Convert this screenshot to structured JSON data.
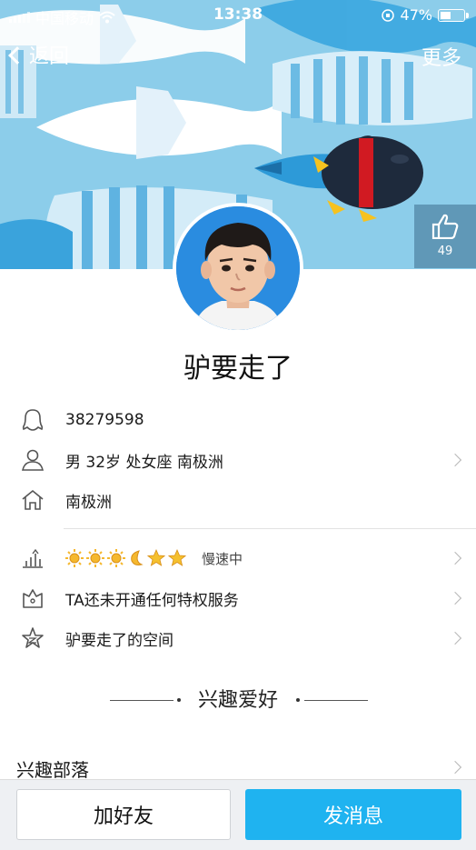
{
  "status_bar": {
    "carrier": "中国移动",
    "time": "13:38",
    "battery": "47%"
  },
  "nav": {
    "back_label": "返回",
    "more_label": "更多"
  },
  "like": {
    "icon": "thumbs-up-icon",
    "count": "49"
  },
  "profile": {
    "nickname": "驴要走了",
    "qq_number": "38279598",
    "basic_info": "男  32岁  处女座  南极洲",
    "hometown": "南极洲",
    "level_icons": [
      "sun",
      "sun",
      "sun",
      "moon",
      "star",
      "star"
    ],
    "level_speed": "慢速中",
    "privilege": "TA还未开通任何特权服务",
    "space": "驴要走了的空间"
  },
  "interests": {
    "section_title": "兴趣爱好",
    "tribe_label": "兴趣部落"
  },
  "actions": {
    "add_friend": "加好友",
    "send_message": "发消息"
  },
  "colors": {
    "banner_bg": "#8ccdea",
    "primary_button": "#1fb3f0",
    "sun": "#f5b82e",
    "star": "#f5c02e"
  }
}
